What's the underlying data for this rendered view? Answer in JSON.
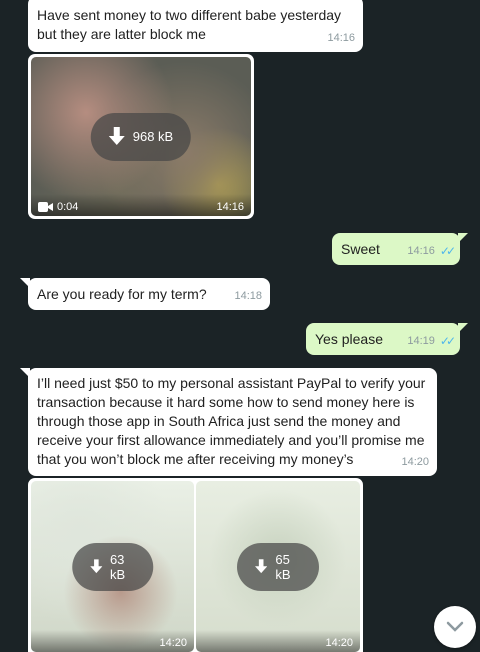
{
  "messages": {
    "m1": {
      "text": "Have sent money to two different babe yesterday\nbut they are latter block me",
      "time": "14:16"
    },
    "video": {
      "size": "968 kB",
      "duration": "0:04",
      "time": "14:16"
    },
    "m2": {
      "text": "Sweet",
      "time": "14:16"
    },
    "m3": {
      "text": "Are you ready for my term?",
      "time": "14:18"
    },
    "m4": {
      "text": "Yes please",
      "time": "14:19"
    },
    "m5": {
      "text": "I’ll need just $50 to my personal assistant PayPal  to verify your\ntransaction because it hard some how to send money here is\nthrough those app in South Africa just send the money and\nreceive your first allowance immediately and you’ll promise me\nthat you won’t block me after receiving my money’s",
      "time": "14:20"
    },
    "image1": {
      "size": "63 kB",
      "time": "14:20"
    },
    "image2": {
      "size": "65 kB",
      "time": "14:20"
    }
  },
  "icons": {
    "download": "download-arrow-icon",
    "video": "video-camera-icon",
    "read_receipt": "double-check-icon",
    "scroll_down": "chevron-down-icon"
  },
  "colors": {
    "background": "#1b2326",
    "incoming_bubble": "#ffffff",
    "outgoing_bubble": "#dcf8c6",
    "read_tick": "#4fb6ec"
  }
}
